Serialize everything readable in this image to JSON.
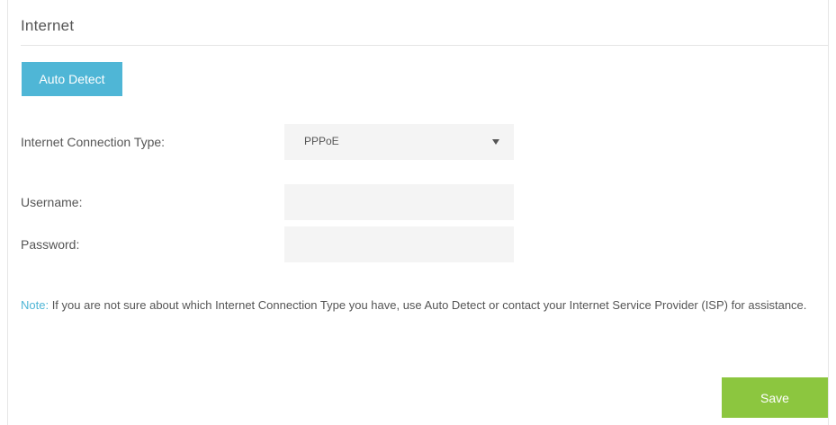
{
  "page": {
    "title": "Internet"
  },
  "buttons": {
    "auto_detect": "Auto Detect",
    "save": "Save"
  },
  "form": {
    "connection_type_label": "Internet Connection Type:",
    "connection_type_value": "PPPoE",
    "username_label": "Username:",
    "username_value": "",
    "password_label": "Password:",
    "password_value": ""
  },
  "note": {
    "label": "Note:",
    "text": " If you are not sure about which Internet Connection Type you have, use Auto Detect or contact your Internet Service Provider (ISP) for assistance."
  },
  "colors": {
    "accent": "#4fb6d6",
    "save": "#8cc63f",
    "field_bg": "#f4f4f4"
  },
  "icons": {
    "dropdown": "chevron-down-icon"
  }
}
